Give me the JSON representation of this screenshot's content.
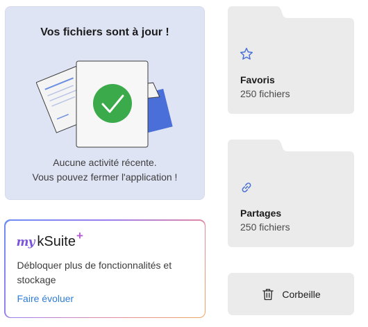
{
  "status": {
    "title": "Vos fichiers sont à jour !",
    "description_line1": "Aucune activité récente.",
    "description_line2": "Vous pouvez fermer l'application !"
  },
  "folders": [
    {
      "name": "Favoris",
      "count": "250 fichiers",
      "icon": "star-icon"
    },
    {
      "name": "Partages",
      "count": "250 fichiers",
      "icon": "link-icon"
    }
  ],
  "trash": {
    "label": "Corbeille",
    "icon": "trash-icon"
  },
  "ksuite": {
    "logo_my": "my",
    "logo_name": "kSuite",
    "logo_plus": "+",
    "description": "Débloquer plus de fonctionnalités et stockage",
    "link_label": "Faire évoluer"
  },
  "colors": {
    "status_bg": "#dfe4f4",
    "folder_bg": "#ebebeb",
    "accent_blue": "#4a6fd8",
    "success_green": "#3aaa4a",
    "link_blue": "#2f7ed8"
  }
}
